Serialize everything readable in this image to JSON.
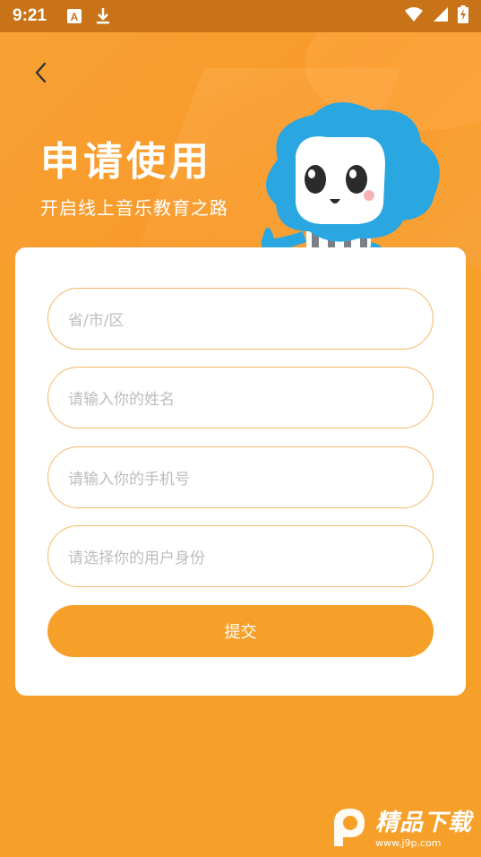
{
  "status_bar": {
    "time": "9:21"
  },
  "header": {
    "title": "申请使用",
    "subtitle": "开启线上音乐教育之路"
  },
  "form": {
    "region_placeholder": "省/市/区",
    "name_placeholder": "请输入你的姓名",
    "phone_placeholder": "请输入你的手机号",
    "identity_placeholder": "请选择你的用户身份",
    "submit_label": "提交"
  },
  "colors": {
    "accent": "#f6a02a",
    "status_bar": "#c97318",
    "field_border": "#f4b868",
    "mascot_blue": "#2aa6e0"
  },
  "icons": {
    "back": "chevron-left-icon",
    "keyboard": "keyboard-a-icon",
    "download": "download-icon",
    "wifi": "wifi-icon",
    "signal": "signal-icon",
    "battery": "battery-charging-icon"
  },
  "watermark": {
    "title": "精品下载",
    "url": "www.j9p.com"
  }
}
